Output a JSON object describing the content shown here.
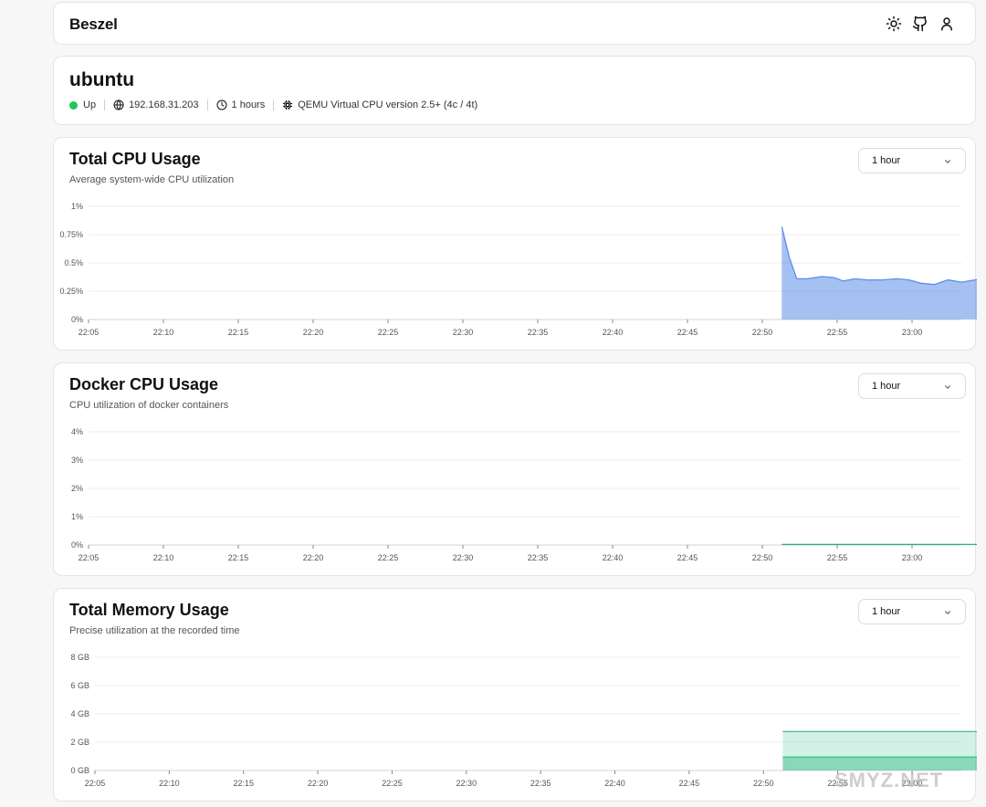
{
  "app": {
    "brand": "Beszel"
  },
  "header": {
    "icons": [
      "sun-icon",
      "github-icon",
      "user-icon"
    ]
  },
  "system": {
    "name": "ubuntu",
    "status": "Up",
    "ip": "192.168.31.203",
    "uptime": "1 hours",
    "cpu_model": "QEMU Virtual CPU version 2.5+ (4c / 4t)"
  },
  "colors": {
    "status_up": "#22c55e",
    "cpu": "#5b8ee8",
    "docker": "#2faa7f",
    "memory": "#3cc08b"
  },
  "charts": {
    "cpu": {
      "title": "Total CPU Usage",
      "subtitle": "Average system-wide CPU utilization",
      "range": "1 hour"
    },
    "docker": {
      "title": "Docker CPU Usage",
      "subtitle": "CPU utilization of docker containers",
      "range": "1 hour"
    },
    "memory": {
      "title": "Total Memory Usage",
      "subtitle": "Precise utilization at the recorded time",
      "range": "1 hour"
    }
  },
  "chart_data": [
    {
      "id": "cpu",
      "type": "area",
      "title": "Total CPU Usage",
      "ylabels": [
        "0%",
        "0.25%",
        "0.5%",
        "0.75%",
        "1%"
      ],
      "ylim": [
        0,
        1
      ],
      "xticks": [
        "22:05",
        "22:10",
        "22:15",
        "22:20",
        "22:25",
        "22:30",
        "22:35",
        "22:40",
        "22:45",
        "22:50",
        "22:55",
        "23:00"
      ],
      "x_minutes": [
        46.3,
        46.8,
        47.3,
        48.0,
        49.0,
        49.8,
        50.4,
        51.2,
        52.0,
        53.0,
        54.0,
        54.8,
        55.6,
        56.5,
        57.4,
        58.3,
        59.2,
        60.2,
        61.0
      ],
      "values": [
        0.82,
        0.55,
        0.36,
        0.36,
        0.38,
        0.37,
        0.34,
        0.36,
        0.35,
        0.35,
        0.36,
        0.35,
        0.32,
        0.31,
        0.35,
        0.33,
        0.35,
        0.37,
        0.36
      ],
      "grid": true
    },
    {
      "id": "docker",
      "type": "area",
      "title": "Docker CPU Usage",
      "ylabels": [
        "0%",
        "1%",
        "2%",
        "3%",
        "4%"
      ],
      "ylim": [
        0,
        4
      ],
      "xticks": [
        "22:05",
        "22:10",
        "22:15",
        "22:20",
        "22:25",
        "22:30",
        "22:35",
        "22:40",
        "22:45",
        "22:50",
        "22:55",
        "23:00"
      ],
      "x_minutes": [
        46.3,
        61.0
      ],
      "values": [
        0.02,
        0.02
      ],
      "grid": true
    },
    {
      "id": "memory",
      "type": "area",
      "title": "Total Memory Usage",
      "ylabels": [
        "0 GB",
        "2 GB",
        "4 GB",
        "6 GB",
        "8 GB"
      ],
      "ylim": [
        0,
        8
      ],
      "xticks": [
        "22:05",
        "22:10",
        "22:15",
        "22:20",
        "22:25",
        "22:30",
        "22:35",
        "22:40",
        "22:45",
        "22:50",
        "22:55",
        "23:00"
      ],
      "x_minutes": [
        46.3,
        61.0
      ],
      "series": [
        {
          "values": [
            2.75,
            2.75
          ]
        },
        {
          "values": [
            0.95,
            0.95
          ]
        }
      ],
      "grid": true
    }
  ]
}
